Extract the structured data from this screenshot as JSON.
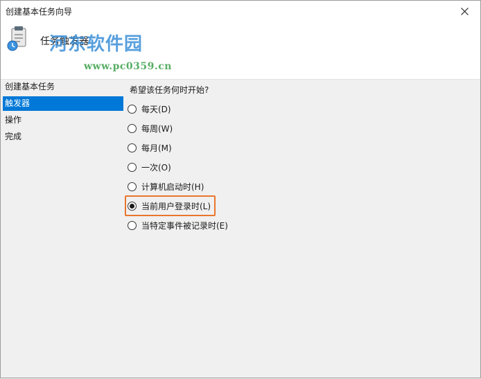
{
  "window": {
    "title": "创建基本任务向导"
  },
  "header": {
    "title": "任务触发器",
    "watermark_brand": "河东软件园",
    "watermark_url": "www.pc0359.cn"
  },
  "steps": [
    {
      "label": "创建基本任务",
      "active": false
    },
    {
      "label": "触发器",
      "active": true
    },
    {
      "label": "操作",
      "active": false
    },
    {
      "label": "完成",
      "active": false
    }
  ],
  "trigger": {
    "question": "希望该任务何时开始?",
    "options": [
      {
        "label": "每天(D)",
        "checked": false
      },
      {
        "label": "每周(W)",
        "checked": false
      },
      {
        "label": "每月(M)",
        "checked": false
      },
      {
        "label": "一次(O)",
        "checked": false
      },
      {
        "label": "计算机启动时(H)",
        "checked": false
      },
      {
        "label": "当前用户登录时(L)",
        "checked": true
      },
      {
        "label": "当特定事件被记录时(E)",
        "checked": false
      }
    ]
  },
  "colors": {
    "accent": "#0078d7",
    "highlight": "#e8762d"
  },
  "icons": {
    "close": "close-icon",
    "task": "task-scheduler-icon"
  }
}
